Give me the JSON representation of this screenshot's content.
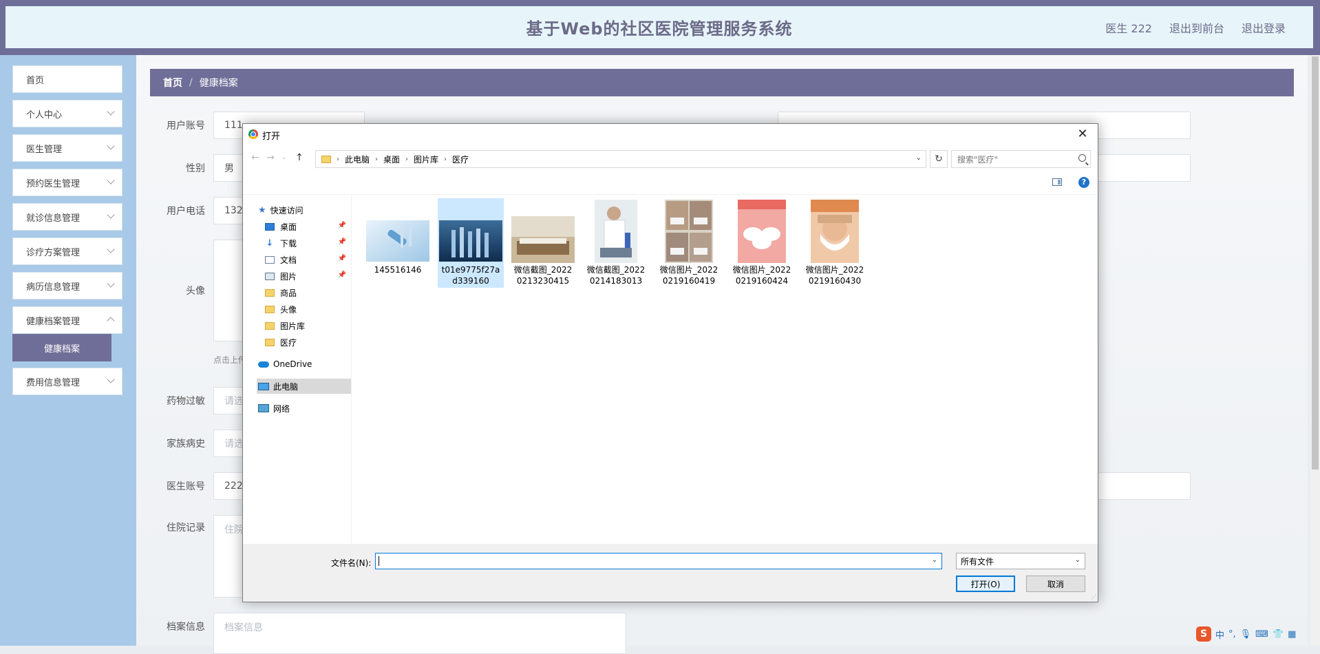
{
  "header": {
    "title": "基于Web的社区医院管理服务系统",
    "user": "医生 222",
    "to_front": "退出到前台",
    "logout": "退出登录"
  },
  "sidebar": {
    "items": [
      {
        "label": "首页"
      },
      {
        "label": "个人中心"
      },
      {
        "label": "医生管理"
      },
      {
        "label": "预约医生管理"
      },
      {
        "label": "就诊信息管理"
      },
      {
        "label": "诊疗方案管理"
      },
      {
        "label": "病历信息管理"
      },
      {
        "label": "健康档案管理"
      },
      {
        "label": "费用信息管理"
      }
    ],
    "active_sub": "健康档案"
  },
  "breadcrumb": {
    "home": "首页",
    "current": "健康档案"
  },
  "form": {
    "account_label": "用户账号",
    "account_value": "111",
    "gender_label": "性别",
    "gender_value": "男",
    "phone_label": "用户电话",
    "phone_value": "1324",
    "avatar_label": "头像",
    "upload_tip": "点击上传",
    "allergy_label": "药物过敏",
    "allergy_placeholder": "请选",
    "family_label": "家族病史",
    "family_placeholder": "请选",
    "doctor_label": "医生账号",
    "doctor_value": "222",
    "hospital_label": "住院记录",
    "hospital_placeholder": "住院",
    "archive_label": "档案信息",
    "archive_placeholder": "档案信息"
  },
  "dialog": {
    "title": "打开",
    "path": [
      "此电脑",
      "桌面",
      "图片库",
      "医疗"
    ],
    "search_placeholder": "搜索\"医疗\"",
    "nav": {
      "quick_access": "快速访问",
      "items": [
        {
          "label": "桌面",
          "icon": "desktop-icon",
          "pinned": true
        },
        {
          "label": "下载",
          "icon": "download-icon",
          "pinned": true
        },
        {
          "label": "文档",
          "icon": "document-icon",
          "pinned": true
        },
        {
          "label": "图片",
          "icon": "pictures-icon",
          "pinned": true
        },
        {
          "label": "商品",
          "icon": "folder-icon",
          "pinned": false
        },
        {
          "label": "头像",
          "icon": "folder-icon",
          "pinned": false
        },
        {
          "label": "图片库",
          "icon": "folder-icon",
          "pinned": false
        },
        {
          "label": "医疗",
          "icon": "folder-icon",
          "pinned": false
        }
      ],
      "onedrive": "OneDrive",
      "this_pc": "此电脑",
      "network": "网络"
    },
    "files": [
      {
        "name": "145516146"
      },
      {
        "name": "t01e9775f27ad339160"
      },
      {
        "name": "微信截图_20220213230415"
      },
      {
        "name": "微信截图_20220214183013"
      },
      {
        "name": "微信图片_20220219160419"
      },
      {
        "name": "微信图片_20220219160424"
      },
      {
        "name": "微信图片_20220219160430"
      }
    ],
    "filename_label": "文件名(N):",
    "filename_value": "",
    "filetype": "所有文件",
    "open_button": "打开(O)",
    "cancel_button": "取消"
  },
  "ime": {
    "mode": "中",
    "punct": "°,"
  },
  "colors": {
    "brand": "#6f6e98",
    "sidebar": "#a9c9e8",
    "header_bg": "#e7f5fb",
    "selection": "#cce8ff",
    "focus": "#0078d7"
  }
}
